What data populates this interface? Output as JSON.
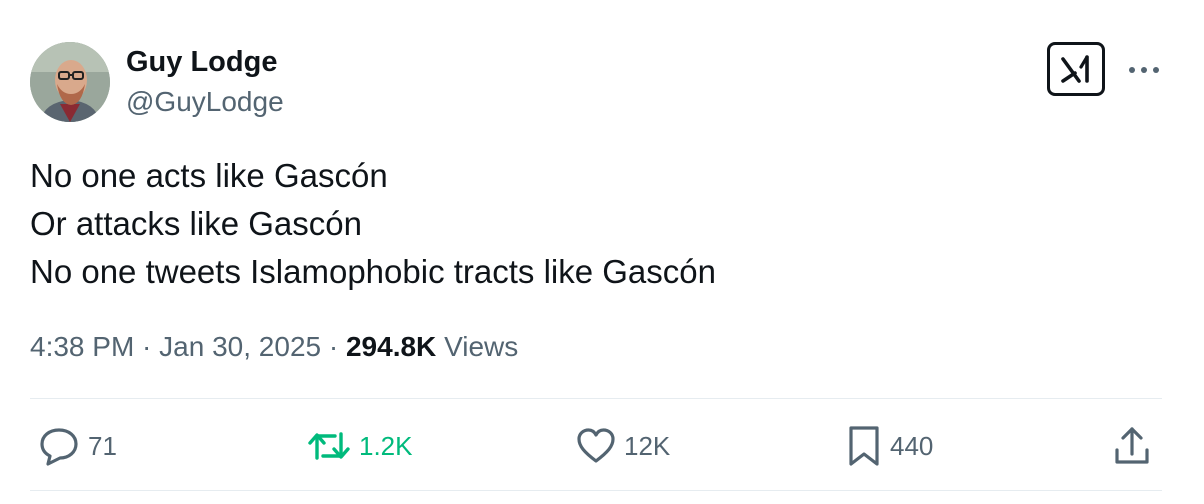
{
  "author": {
    "display_name": "Guy Lodge",
    "handle": "@GuyLodge",
    "avatar_icon": "user-avatar-photo"
  },
  "header_actions": {
    "grok_icon": "grok-icon",
    "more_icon": "more-horizontal-icon"
  },
  "tweet": {
    "lines": [
      "No one acts like Gascón",
      "Or attacks like Gascón",
      "No one tweets Islamophobic tracts like Gascón"
    ]
  },
  "meta": {
    "time": "4:38 PM",
    "separator": " · ",
    "date": "Jan 30, 2025",
    "views_count": "294.8K",
    "views_label": "Views"
  },
  "actions": {
    "replies": {
      "icon": "reply-icon",
      "count": "71"
    },
    "retweets": {
      "icon": "retweet-icon",
      "count": "1.2K",
      "color": "#00ba7c"
    },
    "likes": {
      "icon": "heart-icon",
      "count": "12K"
    },
    "bookmarks": {
      "icon": "bookmark-icon",
      "count": "440"
    },
    "share": {
      "icon": "share-icon"
    }
  },
  "colors": {
    "text_primary": "#0f1419",
    "text_secondary": "#536471",
    "retweet_green": "#00ba7c",
    "divider": "#e6ecf0"
  }
}
